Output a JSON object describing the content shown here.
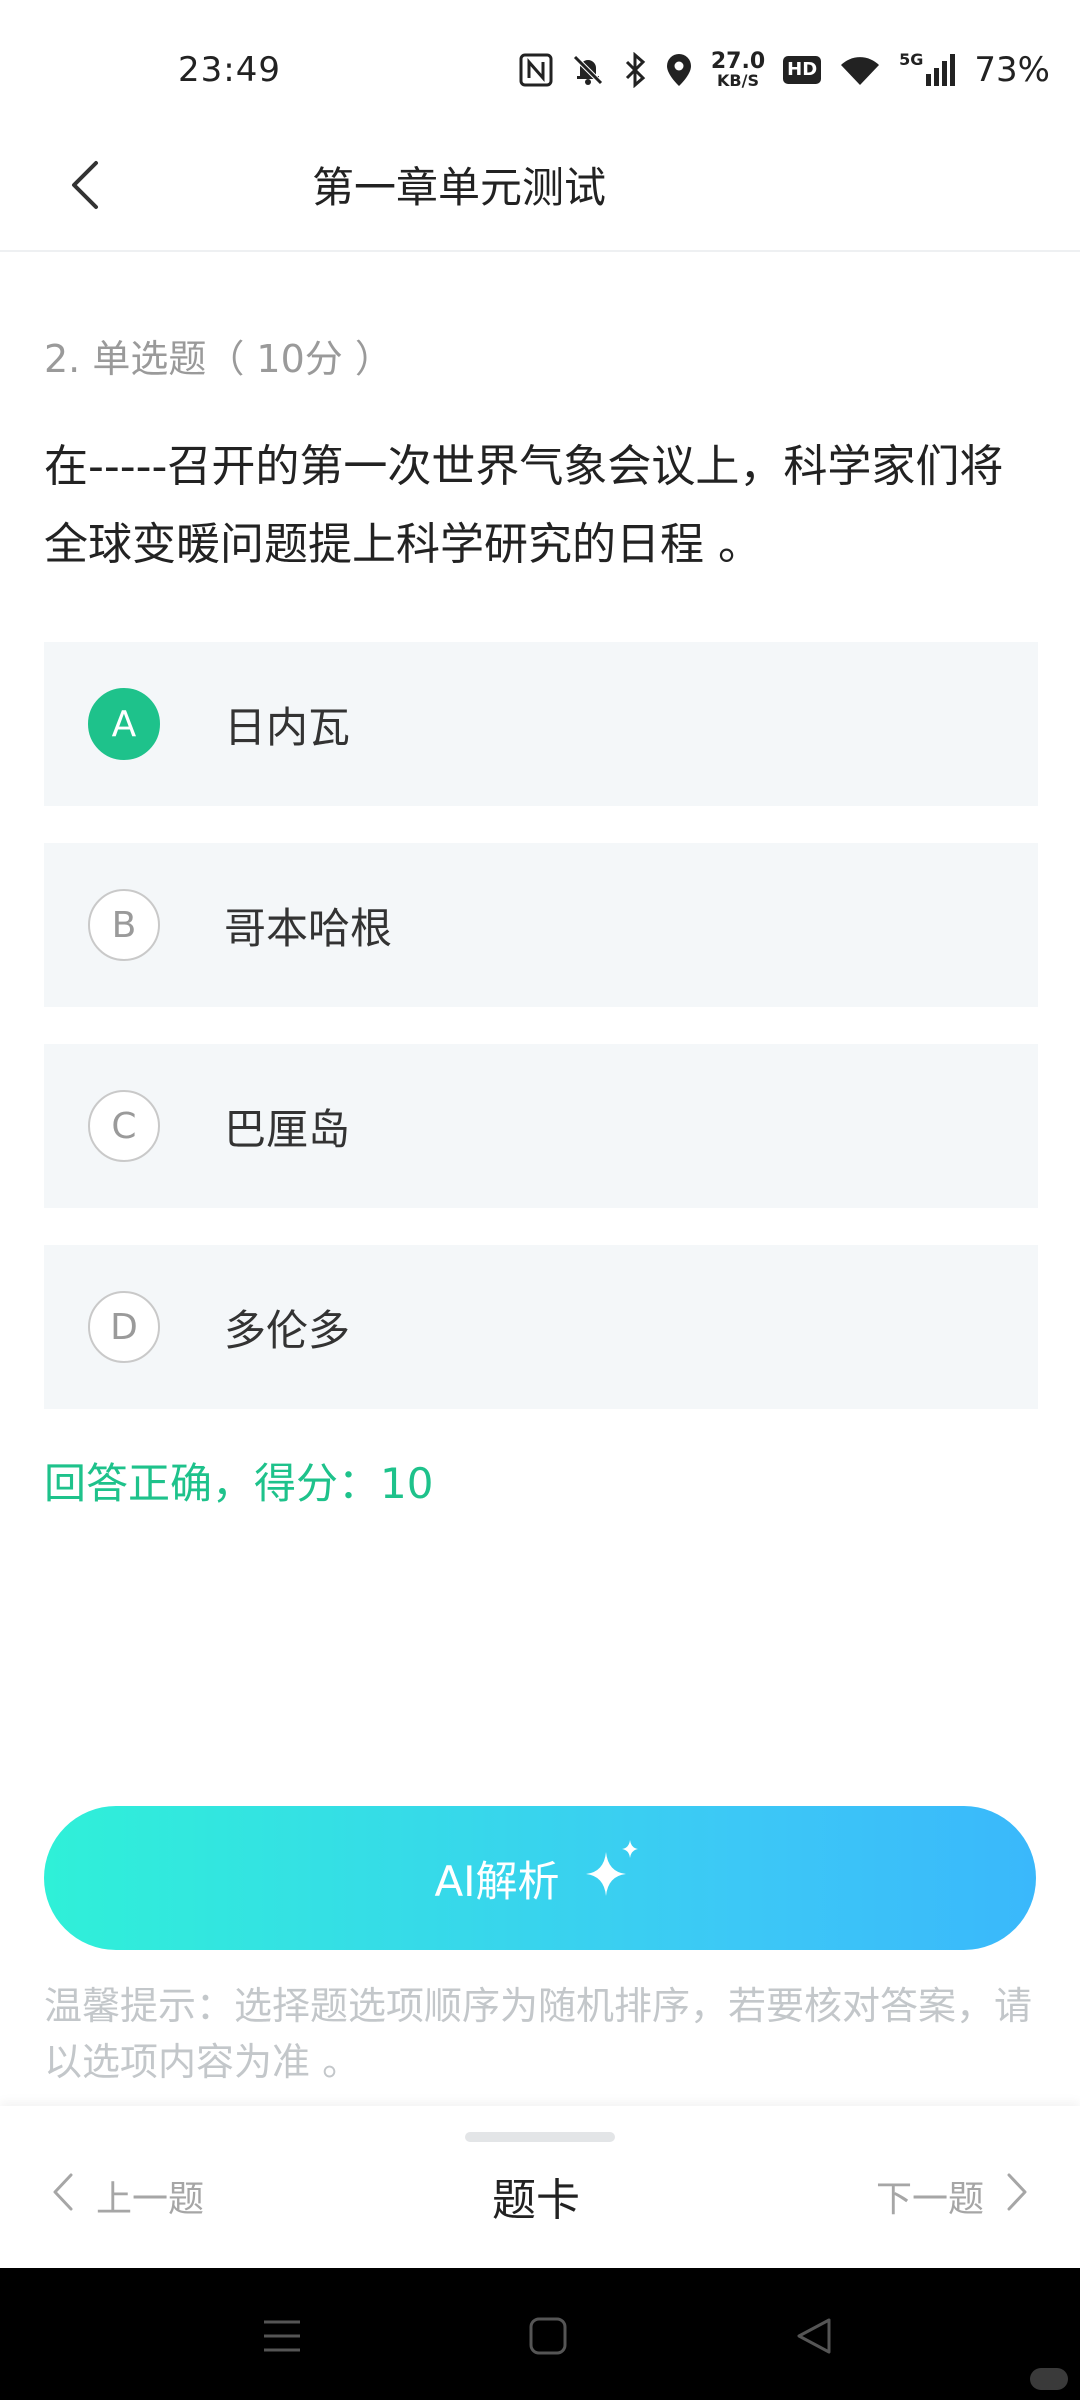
{
  "status_bar": {
    "time": "23:49",
    "network_speed_value": "27.0",
    "network_speed_unit": "KB/S",
    "hd_label": "HD",
    "signal_label": "5G",
    "battery": "73%",
    "icons": [
      "nfc-icon",
      "mute-bell-icon",
      "bluetooth-icon",
      "location-icon",
      "hd-icon",
      "wifi-icon",
      "signal-icon"
    ]
  },
  "header": {
    "title": "第一章单元测试",
    "back_icon": "chevron-left-icon"
  },
  "question": {
    "meta": "2. 单选题（ 10分 ）",
    "text": "在-----召开的第一次世界气象会议上，科学家们将全球变暖问题提上科学研究的日程 。"
  },
  "options": [
    {
      "letter": "A",
      "text": "日内瓦",
      "selected": true
    },
    {
      "letter": "B",
      "text": "哥本哈根",
      "selected": false
    },
    {
      "letter": "C",
      "text": "巴厘岛",
      "selected": false
    },
    {
      "letter": "D",
      "text": "多伦多",
      "selected": false
    }
  ],
  "result": "回答正确，得分：10",
  "ai_button": {
    "label": "AI解析",
    "icon": "sparkle-icon"
  },
  "tip": "温馨提示：选择题选项顺序为随机排序，若要核对答案，请以选项内容为准 。",
  "bottom_nav": {
    "prev": "上一题",
    "card": "题卡",
    "next": "下一题"
  },
  "colors": {
    "accent_green": "#1ec28b",
    "option_bg": "#f4f7f9",
    "ai_gradient_start": "#2ff0d8",
    "ai_gradient_end": "#3ab8fb"
  }
}
